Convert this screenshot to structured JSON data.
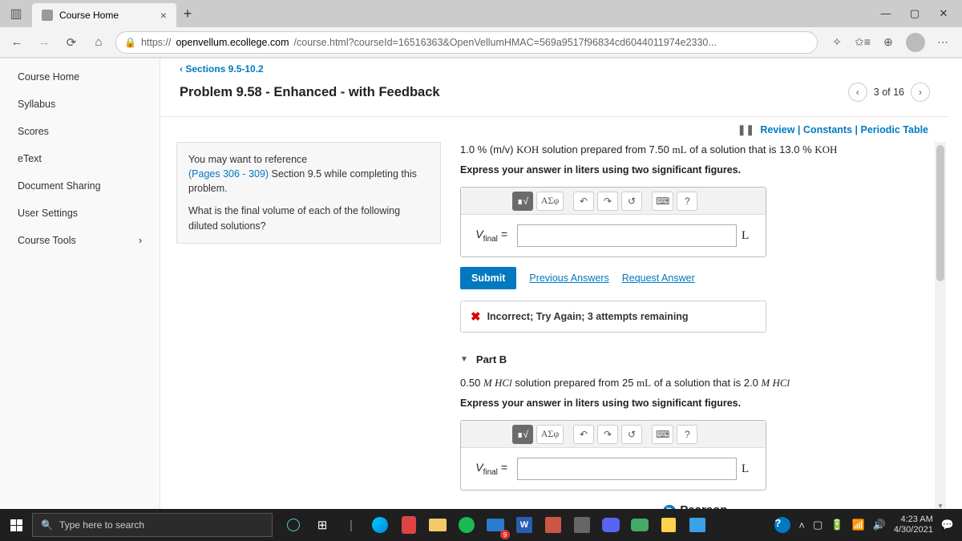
{
  "browser": {
    "tab_title": "Course Home",
    "url_prefix": "https://",
    "url_domain": "openvellum.ecollege.com",
    "url_path": "/course.html?courseId=16516363&OpenVellumHMAC=569a9517f96834cd6044011974e2330..."
  },
  "sidebar": {
    "items": [
      {
        "label": "Course Home"
      },
      {
        "label": "Syllabus"
      },
      {
        "label": "Scores"
      },
      {
        "label": "eText"
      },
      {
        "label": "Document Sharing"
      },
      {
        "label": "User Settings"
      },
      {
        "label": "Course Tools",
        "chevron": "›"
      }
    ]
  },
  "breadcrumb": "‹ Sections 9.5-10.2",
  "problem_title": "Problem 9.58 - Enhanced - with Feedback",
  "pager": {
    "text": "3 of 16"
  },
  "top_links": {
    "pause": "❚❚",
    "review": "Review",
    "constants": "Constants",
    "periodic": "Periodic Table"
  },
  "reference": {
    "line1": "You may want to reference",
    "pages": "(Pages 306 - 309)",
    "line2": " Section 9.5 while completing this problem.",
    "line3": "What is the final volume of each of the following diluted solutions?"
  },
  "partA": {
    "q_pre": "1.0 % (m/v) ",
    "q_chem1": "KOH",
    "q_mid": " solution prepared from 7.50 ",
    "q_unit": "mL",
    "q_mid2": " of a solution that is 13.0 % ",
    "q_chem2": "KOH",
    "instruction": "Express your answer in liters using two significant figures.",
    "var": "V",
    "sub": "final",
    "eq": " =",
    "unit": "L",
    "toolbarSigma": "ΑΣφ",
    "submit": "Submit",
    "prev": "Previous Answers",
    "req": "Request Answer",
    "fb": "Incorrect; Try Again; 3 attempts remaining"
  },
  "partB": {
    "title": "Part B",
    "q_pre": "0.50 ",
    "q_chem1": "M HCl",
    "q_mid": " solution prepared from 25 ",
    "q_unit": "mL",
    "q_mid2": " of a solution that is 2.0 ",
    "q_chem2": "M HCl",
    "instruction": "Express your answer in liters using two significant figures.",
    "var": "V",
    "sub": "final",
    "eq": " =",
    "unit": "L",
    "toolbarSigma": "ΑΣφ"
  },
  "footer_brand": "Pearson",
  "taskbar": {
    "search_placeholder": "Type here to search",
    "badge": "9",
    "time": "4:23 AM",
    "date": "4/30/2021"
  }
}
